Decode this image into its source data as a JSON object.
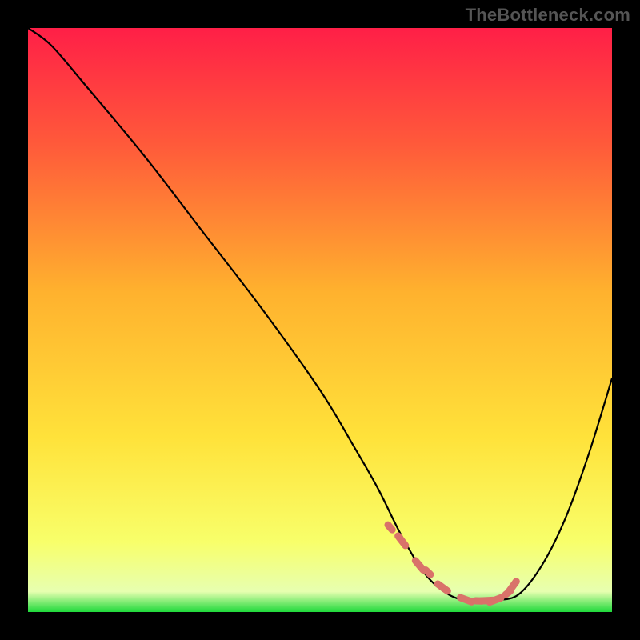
{
  "attribution": "TheBottleneck.com",
  "colors": {
    "background": "#000000",
    "curve": "#000000",
    "marker_fill": "#d9726a",
    "gradient_stops": [
      {
        "offset": 0.0,
        "color": "#ff1f47"
      },
      {
        "offset": 0.2,
        "color": "#ff5a3a"
      },
      {
        "offset": 0.45,
        "color": "#ffb12e"
      },
      {
        "offset": 0.7,
        "color": "#ffe23a"
      },
      {
        "offset": 0.88,
        "color": "#f8ff6a"
      },
      {
        "offset": 0.965,
        "color": "#e7ffb0"
      },
      {
        "offset": 1.0,
        "color": "#1fd93b"
      }
    ]
  },
  "chart_data": {
    "type": "line",
    "title": "",
    "xlabel": "",
    "ylabel": "",
    "xlim": [
      0,
      100
    ],
    "ylim": [
      0,
      100
    ],
    "grid": false,
    "series": [
      {
        "name": "bottleneck-curve",
        "x": [
          0,
          4,
          10,
          20,
          30,
          40,
          50,
          56,
          60,
          64,
          68,
          72,
          76,
          80,
          84,
          88,
          92,
          96,
          100
        ],
        "y": [
          100,
          97,
          90,
          78,
          65,
          52,
          38,
          28,
          21,
          13,
          6.5,
          3,
          1.8,
          2,
          3,
          8,
          16,
          27,
          40
        ]
      }
    ],
    "markers": {
      "name": "trough-dashed-segment",
      "x": [
        62,
        64,
        67,
        68.5,
        71,
        75,
        77.2,
        78.6,
        80,
        82.2,
        83
      ],
      "y": [
        14.5,
        12.2,
        8,
        6.8,
        4.2,
        2.1,
        1.9,
        1.95,
        2.05,
        3.3,
        4.4
      ]
    }
  }
}
